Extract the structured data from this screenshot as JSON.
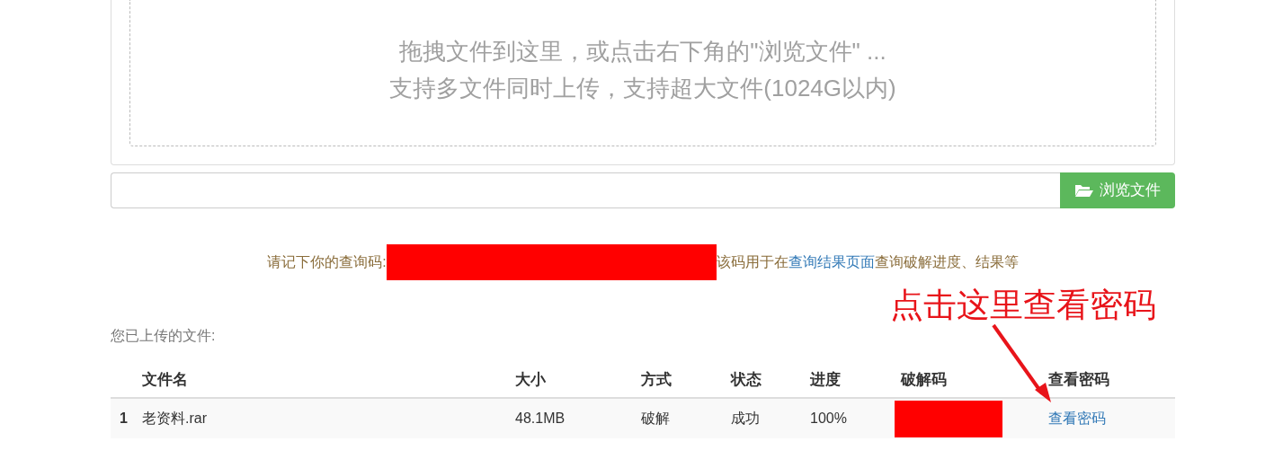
{
  "drop_zone": {
    "lines": [
      "拖拽文件到这里，或点击右下角的\"浏览文件\" ...",
      "支持多文件同时上传，支持超大文件(1024G以内)"
    ]
  },
  "file_input": {
    "button": "浏览文件"
  },
  "notice": {
    "before": "请记下你的查询码:",
    "after": "该码用于在",
    "link": "查询结果页面",
    "tail": "查询破解进度、结果等"
  },
  "annotation": "点击这里查看密码",
  "uploaded_label": "您已上传的文件:",
  "table": {
    "columns": [
      "文件名",
      "大小",
      "方式",
      "状态",
      "进度",
      "破解码",
      "查看密码"
    ],
    "rows": [
      {
        "index": "1",
        "name": "老资料.rar",
        "size": "48.1MB",
        "method": "破解",
        "status": "成功",
        "progress": "100%",
        "link": "查看密码"
      }
    ]
  }
}
